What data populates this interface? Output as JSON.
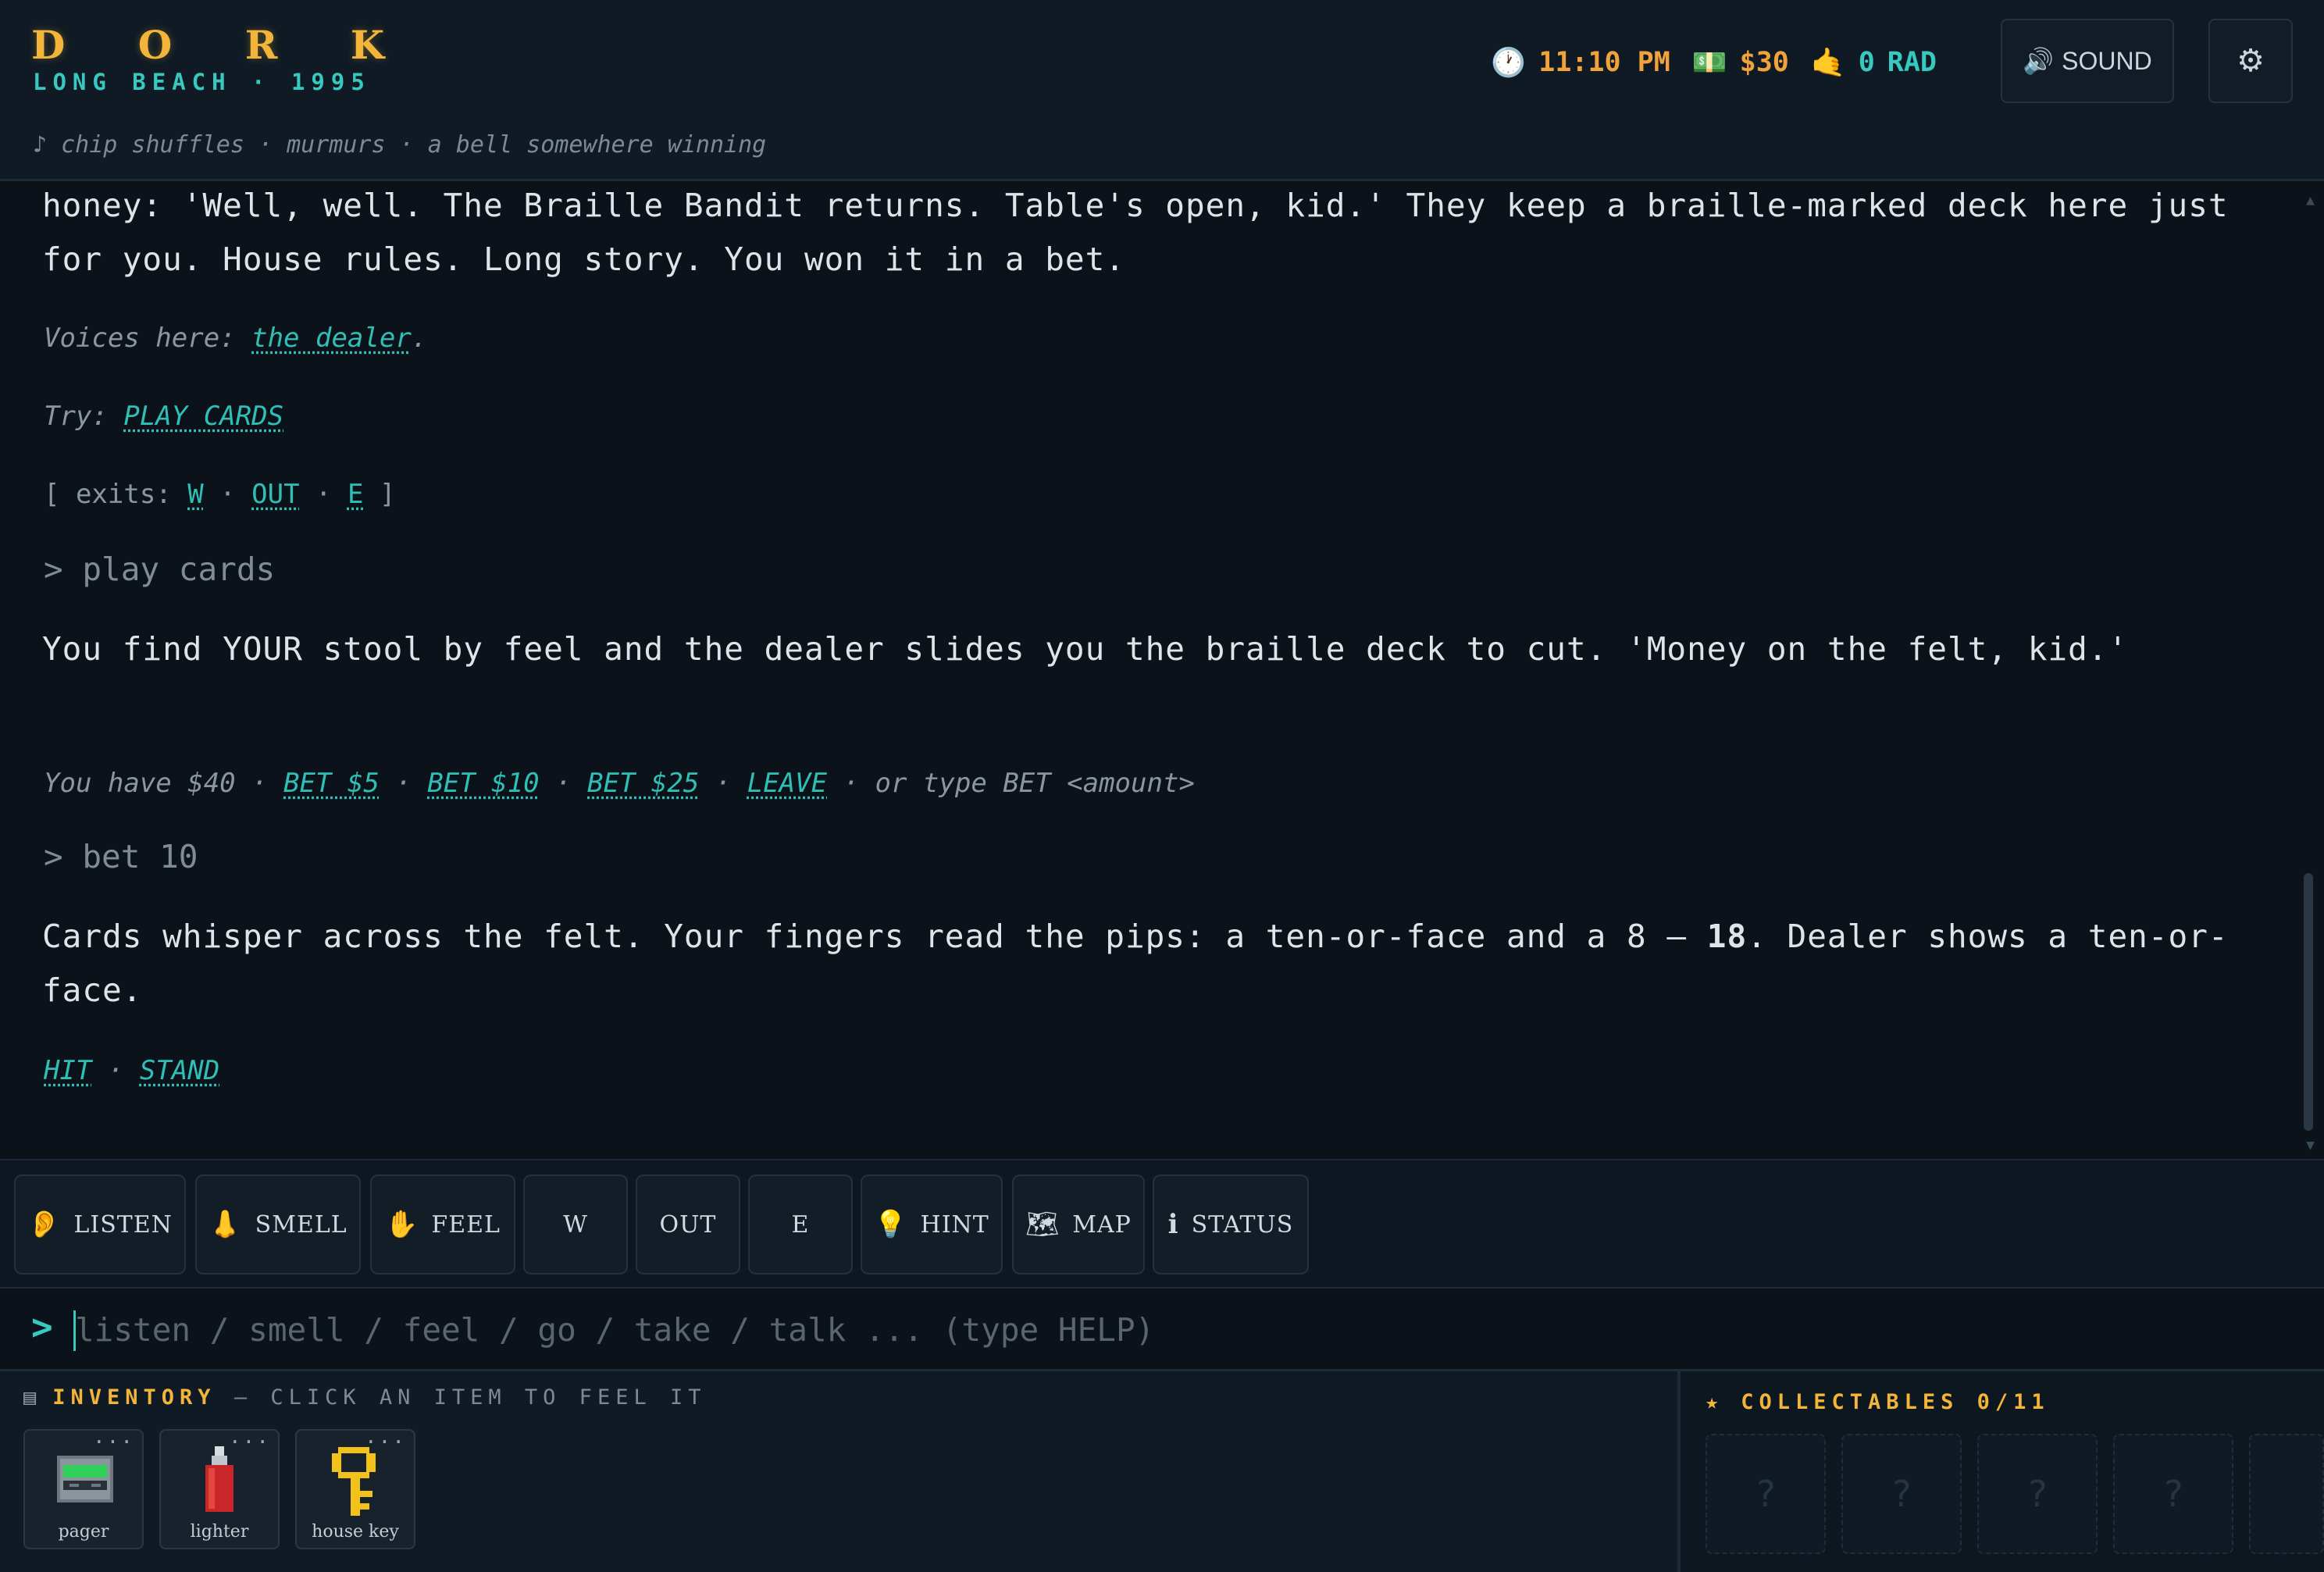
{
  "header": {
    "logo": "D O R K",
    "subtitle": "LONG BEACH · 1995",
    "ambient": "♪ chip shuffles · murmurs · a bell somewhere winning",
    "time": "11:10 PM",
    "money": "$30",
    "rad_value": "0",
    "rad_label": "RAD",
    "sound_label": "SOUND"
  },
  "log": {
    "intro_text": "honey: 'Well, well. The Braille Bandit returns. Table's open, kid.' They keep a braille-marked deck here just for you. House rules. Long story. You won it in a bet.",
    "voices_prefix": "Voices here: ",
    "voices_link": "the dealer",
    "voices_suffix": ".",
    "try_prefix": "Try: ",
    "try_link": "PLAY CARDS",
    "exits_prefix": "[ exits: ",
    "exits": [
      "W",
      "OUT",
      "E"
    ],
    "exits_suffix": " ]",
    "cmd1": "> play cards",
    "play_text": "You find YOUR stool by feel and the dealer slides you the braille deck to cut. 'Money on the felt, kid.'",
    "bet_prefix": "You have $40 · ",
    "bet_links": [
      "BET $5",
      "BET $10",
      "BET $25",
      "LEAVE"
    ],
    "bet_suffix": " · or type BET <amount>",
    "cmd2": "> bet 10",
    "cards_text_a": "Cards whisper across the felt. Your fingers read the pips: a ten-or-face and a 8 — ",
    "cards_total": "18",
    "cards_text_b": ". Dealer shows a ten-or-face.",
    "choices": [
      "HIT",
      "STAND"
    ]
  },
  "actions": [
    {
      "icon": "👂",
      "label": "LISTEN"
    },
    {
      "icon": "👃",
      "label": "SMELL"
    },
    {
      "icon": "✋",
      "label": "FEEL"
    },
    {
      "icon": "",
      "label": "W"
    },
    {
      "icon": "",
      "label": "OUT"
    },
    {
      "icon": "",
      "label": "E"
    },
    {
      "icon": "💡",
      "label": "HINT"
    },
    {
      "icon": "🗺",
      "label": "MAP"
    },
    {
      "icon": "ℹ",
      "label": "STATUS"
    }
  ],
  "command": {
    "prompt": ">",
    "placeholder": "listen / smell / feel / go / take / talk ... (type HELP)"
  },
  "inventory": {
    "title": "INVENTORY",
    "hint": " — CLICK AN ITEM TO FEEL IT",
    "items": [
      {
        "label": "pager",
        "icon": "pager-icon"
      },
      {
        "label": "lighter",
        "icon": "lighter-icon"
      },
      {
        "label": "house key",
        "icon": "key-icon"
      }
    ],
    "more": "···"
  },
  "collectables": {
    "title": "COLLECTABLES 0/11",
    "placeholder": "?"
  },
  "colors": {
    "gold": "#f2b53a",
    "teal": "#37c9c0",
    "orange": "#f2a23a"
  }
}
